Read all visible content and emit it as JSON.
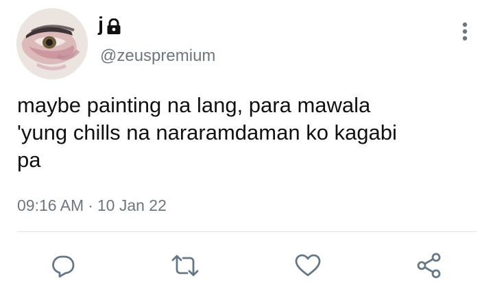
{
  "user": {
    "display_name": "j",
    "handle": "@zeuspremium",
    "protected_icon": "lock-icon"
  },
  "tweet": {
    "text": "maybe painting na lang, para mawala\n'yung chills na nararamdaman ko kagabi\npa",
    "time": "09:16 AM",
    "separator": "·",
    "date": "10 Jan 22"
  },
  "actions": [
    {
      "icon": "reply-icon"
    },
    {
      "icon": "retweet-icon"
    },
    {
      "icon": "like-icon"
    },
    {
      "icon": "share-icon"
    }
  ],
  "colors": {
    "text": "#0f1419",
    "secondary": "#6e767d",
    "icon": "#657786",
    "divider": "#dfe3e6"
  }
}
